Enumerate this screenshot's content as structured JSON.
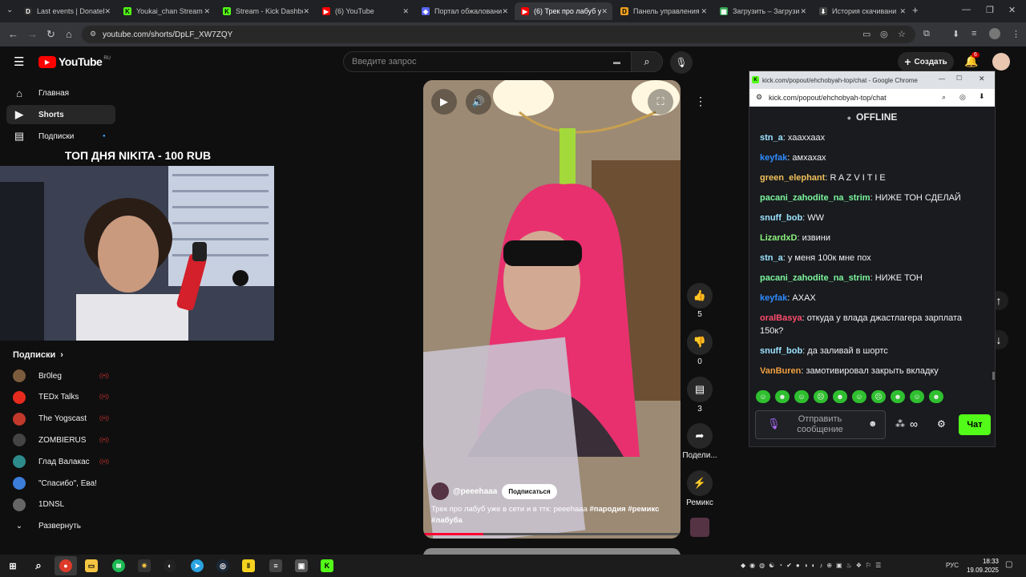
{
  "tabs": [
    {
      "title": "Last events | DonateP",
      "fav": "D",
      "color": "#2b2b2b",
      "fg": "#fff"
    },
    {
      "title": "Youkai_chan Stream",
      "fav": "K",
      "color": "#53fc18",
      "fg": "#000"
    },
    {
      "title": "Stream - Kick Dashbo",
      "fav": "K",
      "color": "#53fc18",
      "fg": "#000"
    },
    {
      "title": "(6) YouTube",
      "fav": "▶",
      "color": "#ff0000",
      "fg": "#fff"
    },
    {
      "title": "Портал обжалования",
      "fav": "◆",
      "color": "#5865f2",
      "fg": "#fff"
    },
    {
      "title": "(6) Трек про лабуб у",
      "fav": "▶",
      "color": "#ff0000",
      "fg": "#fff"
    },
    {
      "title": "Панель управления",
      "fav": "D",
      "color": "#f0a020",
      "fg": "#000"
    },
    {
      "title": "Загрузить – Загрузи",
      "fav": "▦",
      "color": "#34a853",
      "fg": "#fff"
    },
    {
      "title": "История скачивани",
      "fav": "⬇",
      "color": "#444",
      "fg": "#fff"
    }
  ],
  "url": "youtube.com/shorts/DpLF_XW7ZQY",
  "yt": {
    "logo": "YouTube",
    "region": "RU",
    "search_placeholder": "Введите запрос",
    "create": "Создать",
    "notif_count": "6",
    "nav": [
      {
        "label": "Главная",
        "icon": "home-icon",
        "glyph": "⌂"
      },
      {
        "label": "Shorts",
        "icon": "shorts-icon",
        "glyph": "▶"
      },
      {
        "label": "Подписки",
        "icon": "subscriptions-icon",
        "glyph": "▤"
      }
    ],
    "subs_header": "Подписки",
    "subs": [
      {
        "name": "Br0leg",
        "color": "#7a5c3c",
        "live": true
      },
      {
        "name": "TEDx Talks",
        "color": "#e62b1e",
        "live": true
      },
      {
        "name": "The Yogscast",
        "color": "#c0392b",
        "live": true
      },
      {
        "name": "ZOMBIERUS",
        "color": "#444",
        "live": true
      },
      {
        "name": "Глад Валакас",
        "color": "#2e8b8b",
        "live": true
      },
      {
        "name": "\"Спасибо\", Ева!",
        "color": "#3b7dd8",
        "live": false
      },
      {
        "name": "1DNSL",
        "color": "#666",
        "live": false
      }
    ],
    "expand": "Развернуть"
  },
  "overlay": {
    "title": "ТОП ДНЯ NIKITA - 100 RUB"
  },
  "short": {
    "channel": "@peeehaaa",
    "subscribe": "Подписаться",
    "caption": "Трек про лабуб уже в сети и в ттк: peeehaaa ",
    "tags": "#пародия #ремикс #лабуба",
    "likes": "5",
    "dislikes": "0",
    "comments": "3",
    "share": "Подели...",
    "remix": "Ремикс"
  },
  "chat": {
    "window_title": "kick.com/popout/ehchobyah-top/chat - Google Chrome",
    "url": "kick.com/popout/ehchobyah-top/chat",
    "status": "OFFLINE",
    "messages": [
      {
        "user": "stn_a",
        "text": "хааххаах",
        "color": "#9de3ff"
      },
      {
        "user": "keyfak",
        "text": "амхахах",
        "color": "#2f8cff"
      },
      {
        "user": "green_elephant",
        "text": "R A Z V I T I E",
        "color": "#f0c05a"
      },
      {
        "user": "pacani_zahodite_na_strim",
        "text": "НИЖЕ ТОН СДЕЛАЙ",
        "color": "#7cf59c"
      },
      {
        "user": "snuff_bob",
        "text": "WW",
        "color": "#9de3ff"
      },
      {
        "user": "LizardxD",
        "text": "извини",
        "color": "#8cf27e"
      },
      {
        "user": "stn_a",
        "text": "у меня 100к мне пох",
        "color": "#9de3ff"
      },
      {
        "user": "pacani_zahodite_na_strim",
        "text": "НИЖЕ ТОН",
        "color": "#7cf59c"
      },
      {
        "user": "keyfak",
        "text": "АХАХ",
        "color": "#2f8cff"
      },
      {
        "user": "oralBasya",
        "text": "откуда у влада джастлагера зарплата 150к?",
        "color": "#ff4d6d"
      },
      {
        "user": "snuff_bob",
        "text": "да заливай в шортс",
        "color": "#9de3ff"
      },
      {
        "user": "VanBuren",
        "text": "замотивировал закрыть вкладку",
        "color": "#f0a040"
      }
    ],
    "input_placeholder": "Отправить сообщение",
    "send": "Чат"
  },
  "taskbar": {
    "lang": "РУС",
    "time": "18:33",
    "date": "19.09.2025"
  }
}
